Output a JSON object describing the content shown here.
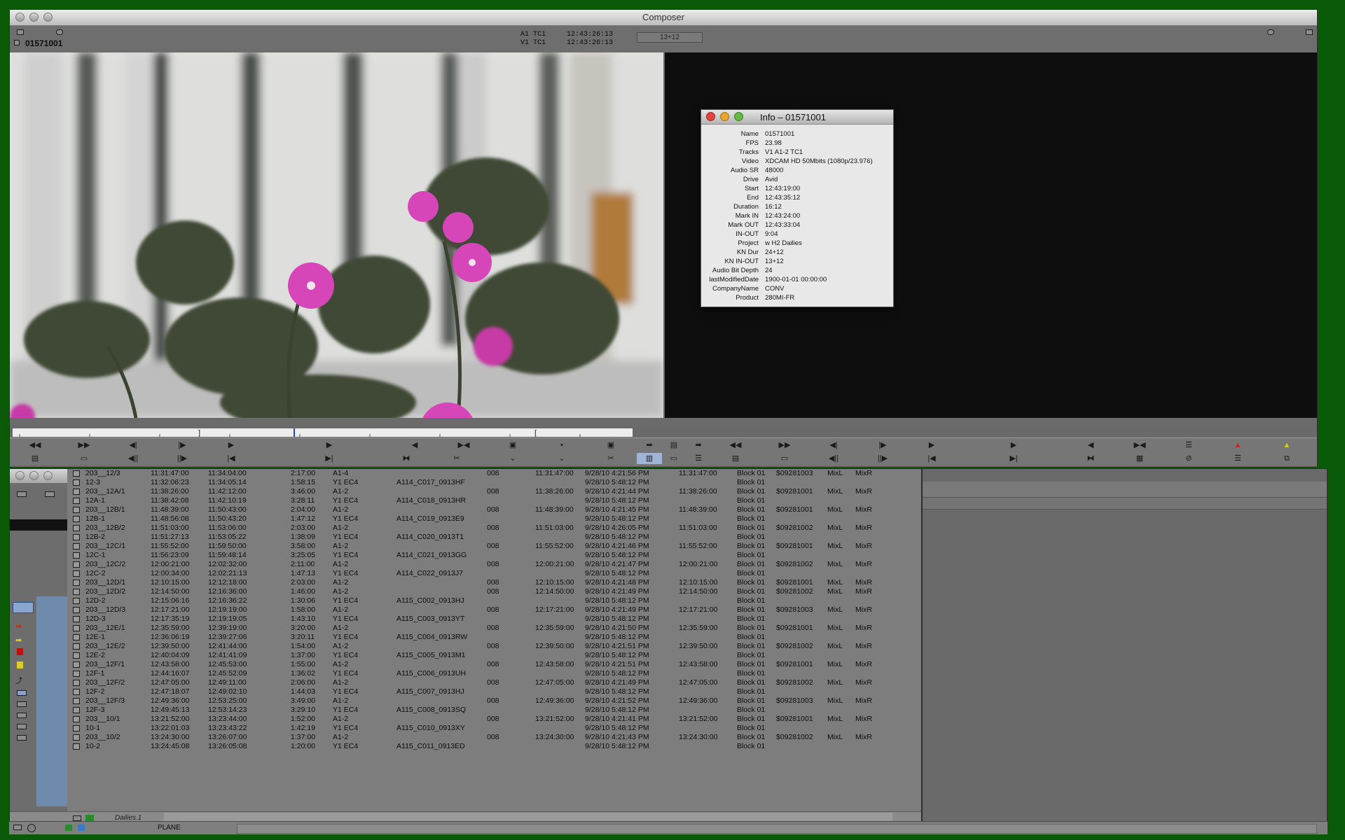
{
  "composer": {
    "title": "Composer",
    "clip_name": "01571001",
    "header": {
      "a1_label": "A1 TC1",
      "v1_label": "V1 TC1",
      "a1_tc": "12:43:26:13",
      "v1_tc": "12:43:26:13",
      "kn_value": "13+12"
    }
  },
  "info": {
    "title": "Info – 01571001",
    "rows": [
      {
        "k": "Name",
        "v": "01571001"
      },
      {
        "k": "FPS",
        "v": "23.98"
      },
      {
        "k": "Tracks",
        "v": "V1 A1-2 TC1"
      },
      {
        "k": "Video",
        "v": "XDCAM HD 50Mbits (1080p/23.976)"
      },
      {
        "k": "Audio SR",
        "v": "48000"
      },
      {
        "k": "Drive",
        "v": "Avid"
      },
      {
        "k": "Start",
        "v": "12:43:19:00"
      },
      {
        "k": "End",
        "v": "12:43:35:12"
      },
      {
        "k": "Duration",
        "v": "16:12"
      },
      {
        "k": "Mark IN",
        "v": "12:43:24:00"
      },
      {
        "k": "Mark OUT",
        "v": "12:43:33:04"
      },
      {
        "k": "IN-OUT",
        "v": "9:04"
      },
      {
        "k": "Project",
        "v": "w H2 Dailies"
      },
      {
        "k": "KN Dur",
        "v": "24+12"
      },
      {
        "k": "KN IN-OUT",
        "v": "13+12"
      },
      {
        "k": "Audio Bit Depth",
        "v": "24"
      },
      {
        "k": "lastModifiedDate",
        "v": "1900-01-01 00:00:00"
      },
      {
        "k": "CompanyName",
        "v": "CONV"
      },
      {
        "k": "Product",
        "v": "280MI-FR"
      }
    ]
  },
  "bin": {
    "tab_name": "Dailies.1",
    "bottom_label": "PLANE",
    "rows": [
      [
        "203__12/3",
        "11:31:47:00",
        "11:34:04:00",
        "2:17:00",
        "A1-4",
        "",
        "008",
        "11:31:47:00",
        "9/28/10 4:21:56 PM",
        "11:31:47:00",
        "Block 01",
        "$09281003",
        "MixL",
        "MixR"
      ],
      [
        "12-3",
        "11:32:06:23",
        "11:34:05:14",
        "1:58:15",
        "Y1 EC4",
        "A114_C017_0913HF",
        "",
        "",
        "9/28/10 5:48:12 PM",
        "",
        "Block 01",
        "",
        "",
        ""
      ],
      [
        "203__12A/1",
        "11:38:26:00",
        "11:42:12:00",
        "3:46:00",
        "A1-2",
        "",
        "008",
        "11:38:26:00",
        "9/28/10 4:21:44 PM",
        "11:38:26:00",
        "Block 01",
        "$09281001",
        "MixL",
        "MixR"
      ],
      [
        "12A-1",
        "11:38:42:08",
        "11:42:10:19",
        "3:28:11",
        "Y1 EC4",
        "A114_C018_0913HR",
        "",
        "",
        "9/28/10 5:48:12 PM",
        "",
        "Block 01",
        "",
        "",
        ""
      ],
      [
        "203__12B/1",
        "11:48:39:00",
        "11:50:43:00",
        "2:04:00",
        "A1-2",
        "",
        "008",
        "11:48:39:00",
        "9/28/10 4:21:45 PM",
        "11:48:39:00",
        "Block 01",
        "$09281001",
        "MixL",
        "MixR"
      ],
      [
        "12B-1",
        "11:48:56:08",
        "11:50:43:20",
        "1:47:12",
        "Y1 EC4",
        "A114_C019_0913E9",
        "",
        "",
        "9/28/10 5:48:12 PM",
        "",
        "Block 01",
        "",
        "",
        ""
      ],
      [
        "203__12B/2",
        "11:51:03:00",
        "11:53:06:00",
        "2:03:00",
        "A1-2",
        "",
        "008",
        "11:51:03:00",
        "9/28/10 4:26:05 PM",
        "11:51:03:00",
        "Block 01",
        "$09281002",
        "MixL",
        "MixR"
      ],
      [
        "12B-2",
        "11:51:27:13",
        "11:53:05:22",
        "1:38:09",
        "Y1 EC4",
        "A114_C020_0913T1",
        "",
        "",
        "9/28/10 5:48:12 PM",
        "",
        "Block 01",
        "",
        "",
        ""
      ],
      [
        "203__12C/1",
        "11:55:52:00",
        "11:59:50:00",
        "3:58:00",
        "A1-2",
        "",
        "008",
        "11:55:52:00",
        "9/28/10 4:21:46 PM",
        "11:55:52:00",
        "Block 01",
        "$09281001",
        "MixL",
        "MixR"
      ],
      [
        "12C-1",
        "11:56:23:09",
        "11:59:48:14",
        "3:25:05",
        "Y1 EC4",
        "A114_C021_0913GG",
        "",
        "",
        "9/28/10 5:48:12 PM",
        "",
        "Block 01",
        "",
        "",
        ""
      ],
      [
        "203__12C/2",
        "12:00:21:00",
        "12:02:32:00",
        "2:11:00",
        "A1-2",
        "",
        "008",
        "12:00:21:00",
        "9/28/10 4:21:47 PM",
        "12:00:21:00",
        "Block 01",
        "$09281002",
        "MixL",
        "MixR"
      ],
      [
        "12C-2",
        "12:00:34:00",
        "12:02:21:13",
        "1:47:13",
        "Y1 EC4",
        "A114_C022_0913J7",
        "",
        "",
        "9/28/10 5:48:12 PM",
        "",
        "Block 01",
        "",
        "",
        ""
      ],
      [
        "203__12D/1",
        "12:10:15:00",
        "12:12:18:00",
        "2:03:00",
        "A1-2",
        "",
        "008",
        "12:10:15:00",
        "9/28/10 4:21:48 PM",
        "12:10:15:00",
        "Block 01",
        "$09281001",
        "MixL",
        "MixR"
      ],
      [
        "203__12D/2",
        "12:14:50:00",
        "12:16:36:00",
        "1:46:00",
        "A1-2",
        "",
        "008",
        "12:14:50:00",
        "9/28/10 4:21:49 PM",
        "12:14:50:00",
        "Block 01",
        "$09281002",
        "MixL",
        "MixR"
      ],
      [
        "12D-2",
        "12:15:06:16",
        "12:16:36:22",
        "1:30:06",
        "Y1 EC4",
        "A115_C002_0913HJ",
        "",
        "",
        "9/28/10 5:48:12 PM",
        "",
        "Block 01",
        "",
        "",
        ""
      ],
      [
        "203__12D/3",
        "12:17:21:00",
        "12:19:19:00",
        "1:58:00",
        "A1-2",
        "",
        "008",
        "12:17:21:00",
        "9/28/10 4:21:49 PM",
        "12:17:21:00",
        "Block 01",
        "$09281003",
        "MixL",
        "MixR"
      ],
      [
        "12D-3",
        "12:17:35:19",
        "12:19:19:05",
        "1:43:10",
        "Y1 EC4",
        "A115_C003_0913YT",
        "",
        "",
        "9/28/10 5:48:12 PM",
        "",
        "Block 01",
        "",
        "",
        ""
      ],
      [
        "203__12E/1",
        "12:35:59:00",
        "12:39:19:00",
        "3:20:00",
        "A1-2",
        "",
        "008",
        "12:35:59:00",
        "9/28/10 4:21:50 PM",
        "12:35:59:00",
        "Block 01",
        "$09281001",
        "MixL",
        "MixR"
      ],
      [
        "12E-1",
        "12:36:06:19",
        "12:39:27:06",
        "3:20:11",
        "Y1 EC4",
        "A115_C004_0913RW",
        "",
        "",
        "9/28/10 5:48:12 PM",
        "",
        "Block 01",
        "",
        "",
        ""
      ],
      [
        "203__12E/2",
        "12:39:50:00",
        "12:41:44:00",
        "1:54:00",
        "A1-2",
        "",
        "008",
        "12:39:50:00",
        "9/28/10 4:21:51 PM",
        "12:39:50:00",
        "Block 01",
        "$09281002",
        "MixL",
        "MixR"
      ],
      [
        "12E-2",
        "12:40:04:09",
        "12:41:41:09",
        "1:37:00",
        "Y1 EC4",
        "A115_C005_0913M1",
        "",
        "",
        "9/28/10 5:48:12 PM",
        "",
        "Block 01",
        "",
        "",
        ""
      ],
      [
        "203__12F/1",
        "12:43:58:00",
        "12:45:53:00",
        "1:55:00",
        "A1-2",
        "",
        "008",
        "12:43:58:00",
        "9/28/10 4:21:51 PM",
        "12:43:58:00",
        "Block 01",
        "$09281001",
        "MixL",
        "MixR"
      ],
      [
        "12F-1",
        "12:44:16:07",
        "12:45:52:09",
        "1:36:02",
        "Y1 EC4",
        "A115_C006_0913UH",
        "",
        "",
        "9/28/10 5:48:12 PM",
        "",
        "Block 01",
        "",
        "",
        ""
      ],
      [
        "203__12F/2",
        "12:47:05:00",
        "12:49:11:00",
        "2:06:00",
        "A1-2",
        "",
        "008",
        "12:47:05:00",
        "9/28/10 4:21:49 PM",
        "12:47:05:00",
        "Block 01",
        "$09281002",
        "MixL",
        "MixR"
      ],
      [
        "12F-2",
        "12:47:18:07",
        "12:49:02:10",
        "1:44:03",
        "Y1 EC4",
        "A115_C007_0913HJ",
        "",
        "",
        "9/28/10 5:48:12 PM",
        "",
        "Block 01",
        "",
        "",
        ""
      ],
      [
        "203__12F/3",
        "12:49:36:00",
        "12:53:25:00",
        "3:49:00",
        "A1-2",
        "",
        "008",
        "12:49:36:00",
        "9/28/10 4:21:52 PM",
        "12:49:36:00",
        "Block 01",
        "$09281003",
        "MixL",
        "MixR"
      ],
      [
        "12F-3",
        "12:49:45:13",
        "12:53:14:23",
        "3:29:10",
        "Y1 EC4",
        "A115_C008_0913SQ",
        "",
        "",
        "9/28/10 5:48:12 PM",
        "",
        "Block 01",
        "",
        "",
        ""
      ],
      [
        "203__10/1",
        "13:21:52:00",
        "13:23:44:00",
        "1:52:00",
        "A1-2",
        "",
        "008",
        "13:21:52:00",
        "9/28/10 4:21:41 PM",
        "13:21:52:00",
        "Block 01",
        "$09281001",
        "MixL",
        "MixR"
      ],
      [
        "10-1",
        "13:22:01:03",
        "13:23:43:22",
        "1:42:19",
        "Y1 EC4",
        "A115_C010_0913XY",
        "",
        "",
        "9/28/10 5:48:12 PM",
        "",
        "Block 01",
        "",
        "",
        ""
      ],
      [
        "203__10/2",
        "13:24:30:00",
        "13:26:07:00",
        "1:37:00",
        "A1-2",
        "",
        "008",
        "13:24:30:00",
        "9/28/10 4:21:43 PM",
        "13:24:30:00",
        "Block 01",
        "$09281002",
        "MixL",
        "MixR"
      ],
      [
        "10-2",
        "13:24:45:08",
        "13:26:05:08",
        "1:20:00",
        "Y1 EC4",
        "A115_C011_0913ED",
        "",
        "",
        "9/28/10 5:48:12 PM",
        "",
        "Block 01",
        "",
        "",
        ""
      ]
    ]
  },
  "colors": {
    "desktop": "#0a5a0a",
    "chrome": "#6b6b6b",
    "record_monitor": "#0e0e0e",
    "flower": "#d94bc0"
  }
}
